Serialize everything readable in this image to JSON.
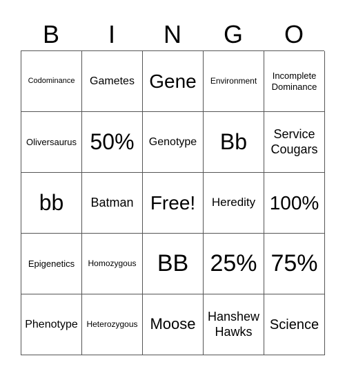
{
  "header": [
    "B",
    "I",
    "N",
    "G",
    "O"
  ],
  "cells": [
    [
      "Codominance",
      "Gametes",
      "Gene",
      "Environment",
      "Incomplete Dominance"
    ],
    [
      "Oliversaurus",
      "50%",
      "Genotype",
      "Bb",
      "Service Cougars"
    ],
    [
      "bb",
      "Batman",
      "Free!",
      "Heredity",
      "100%"
    ],
    [
      "Epigenetics",
      "Homozygous",
      "BB",
      "25%",
      "75%"
    ],
    [
      "Phenotype",
      "Heterozygous",
      "Moose",
      "Hanshew Hawks",
      "Science"
    ]
  ]
}
